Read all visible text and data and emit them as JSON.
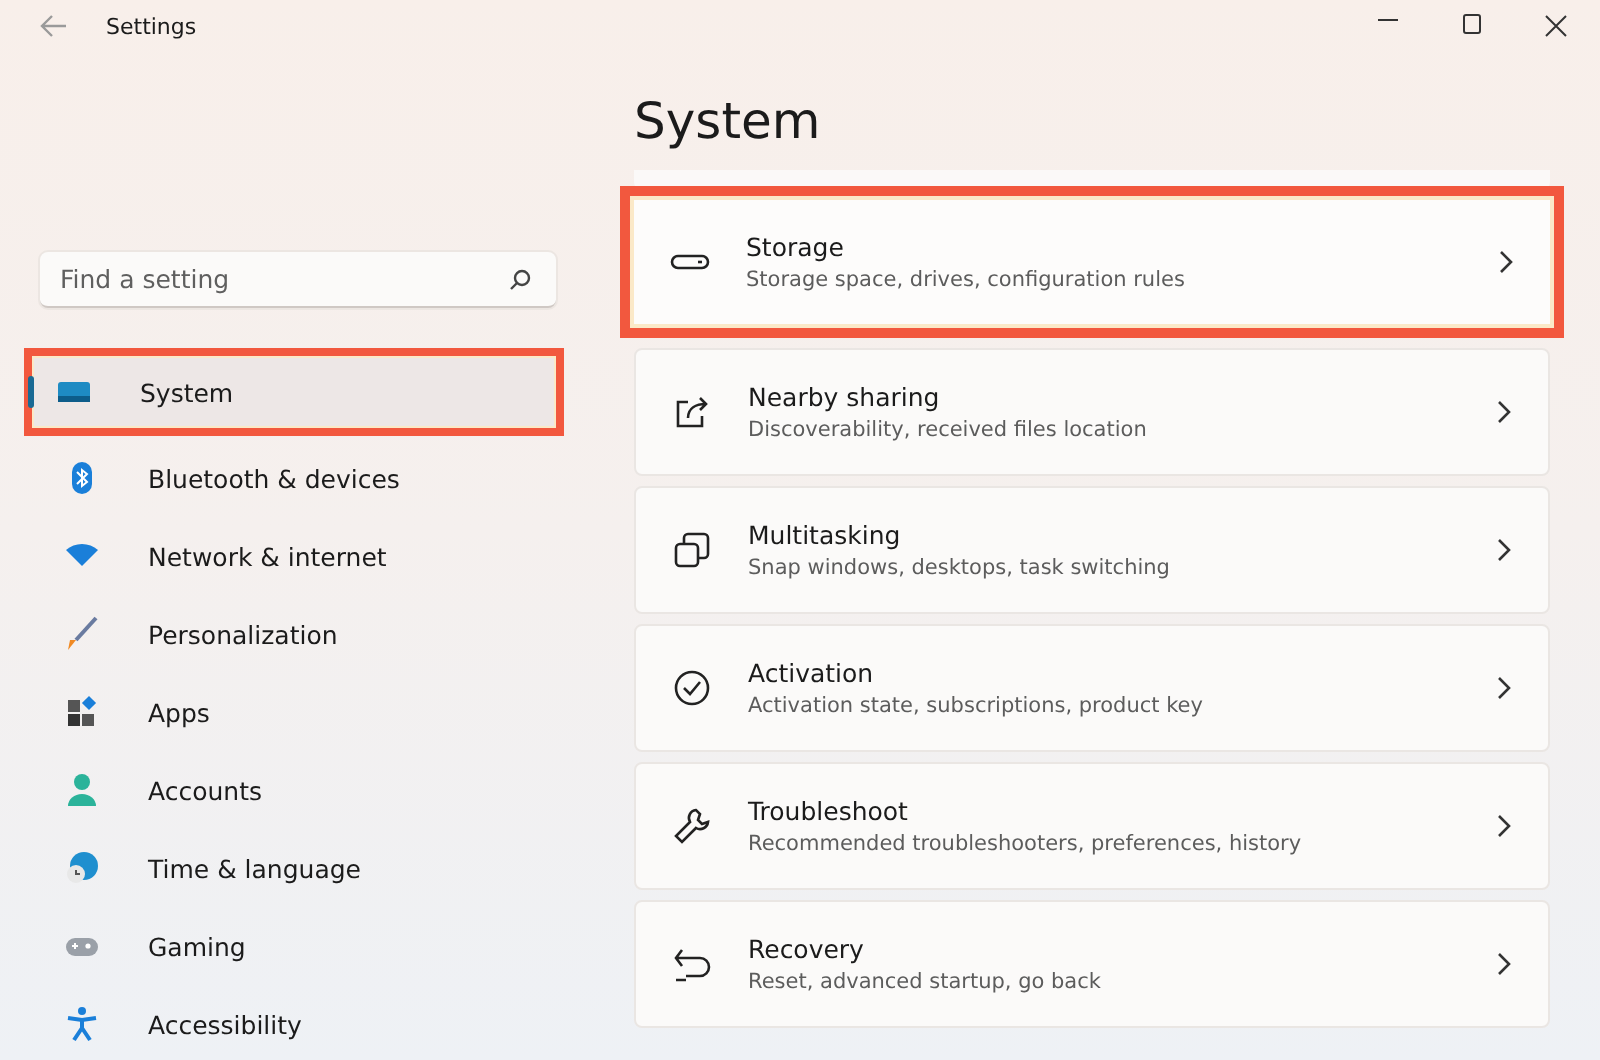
{
  "window": {
    "title": "Settings"
  },
  "search": {
    "placeholder": "Find a setting"
  },
  "sidebar": {
    "items": [
      {
        "label": "System",
        "selected": true,
        "highlighted": true
      },
      {
        "label": "Bluetooth & devices",
        "selected": false,
        "highlighted": false
      },
      {
        "label": "Network & internet",
        "selected": false,
        "highlighted": false
      },
      {
        "label": "Personalization",
        "selected": false,
        "highlighted": false
      },
      {
        "label": "Apps",
        "selected": false,
        "highlighted": false
      },
      {
        "label": "Accounts",
        "selected": false,
        "highlighted": false
      },
      {
        "label": "Time & language",
        "selected": false,
        "highlighted": false
      },
      {
        "label": "Gaming",
        "selected": false,
        "highlighted": false
      },
      {
        "label": "Accessibility",
        "selected": false,
        "highlighted": false
      }
    ]
  },
  "page": {
    "title": "System",
    "cards": [
      {
        "title": "Storage",
        "description": "Storage space, drives, configuration rules",
        "highlighted": true
      },
      {
        "title": "Nearby sharing",
        "description": "Discoverability, received files location",
        "highlighted": false
      },
      {
        "title": "Multitasking",
        "description": "Snap windows, desktops, task switching",
        "highlighted": false
      },
      {
        "title": "Activation",
        "description": "Activation state, subscriptions, product key",
        "highlighted": false
      },
      {
        "title": "Troubleshoot",
        "description": "Recommended troubleshooters, preferences, history",
        "highlighted": false
      },
      {
        "title": "Recovery",
        "description": "Reset, advanced startup, go back",
        "highlighted": false
      }
    ]
  }
}
